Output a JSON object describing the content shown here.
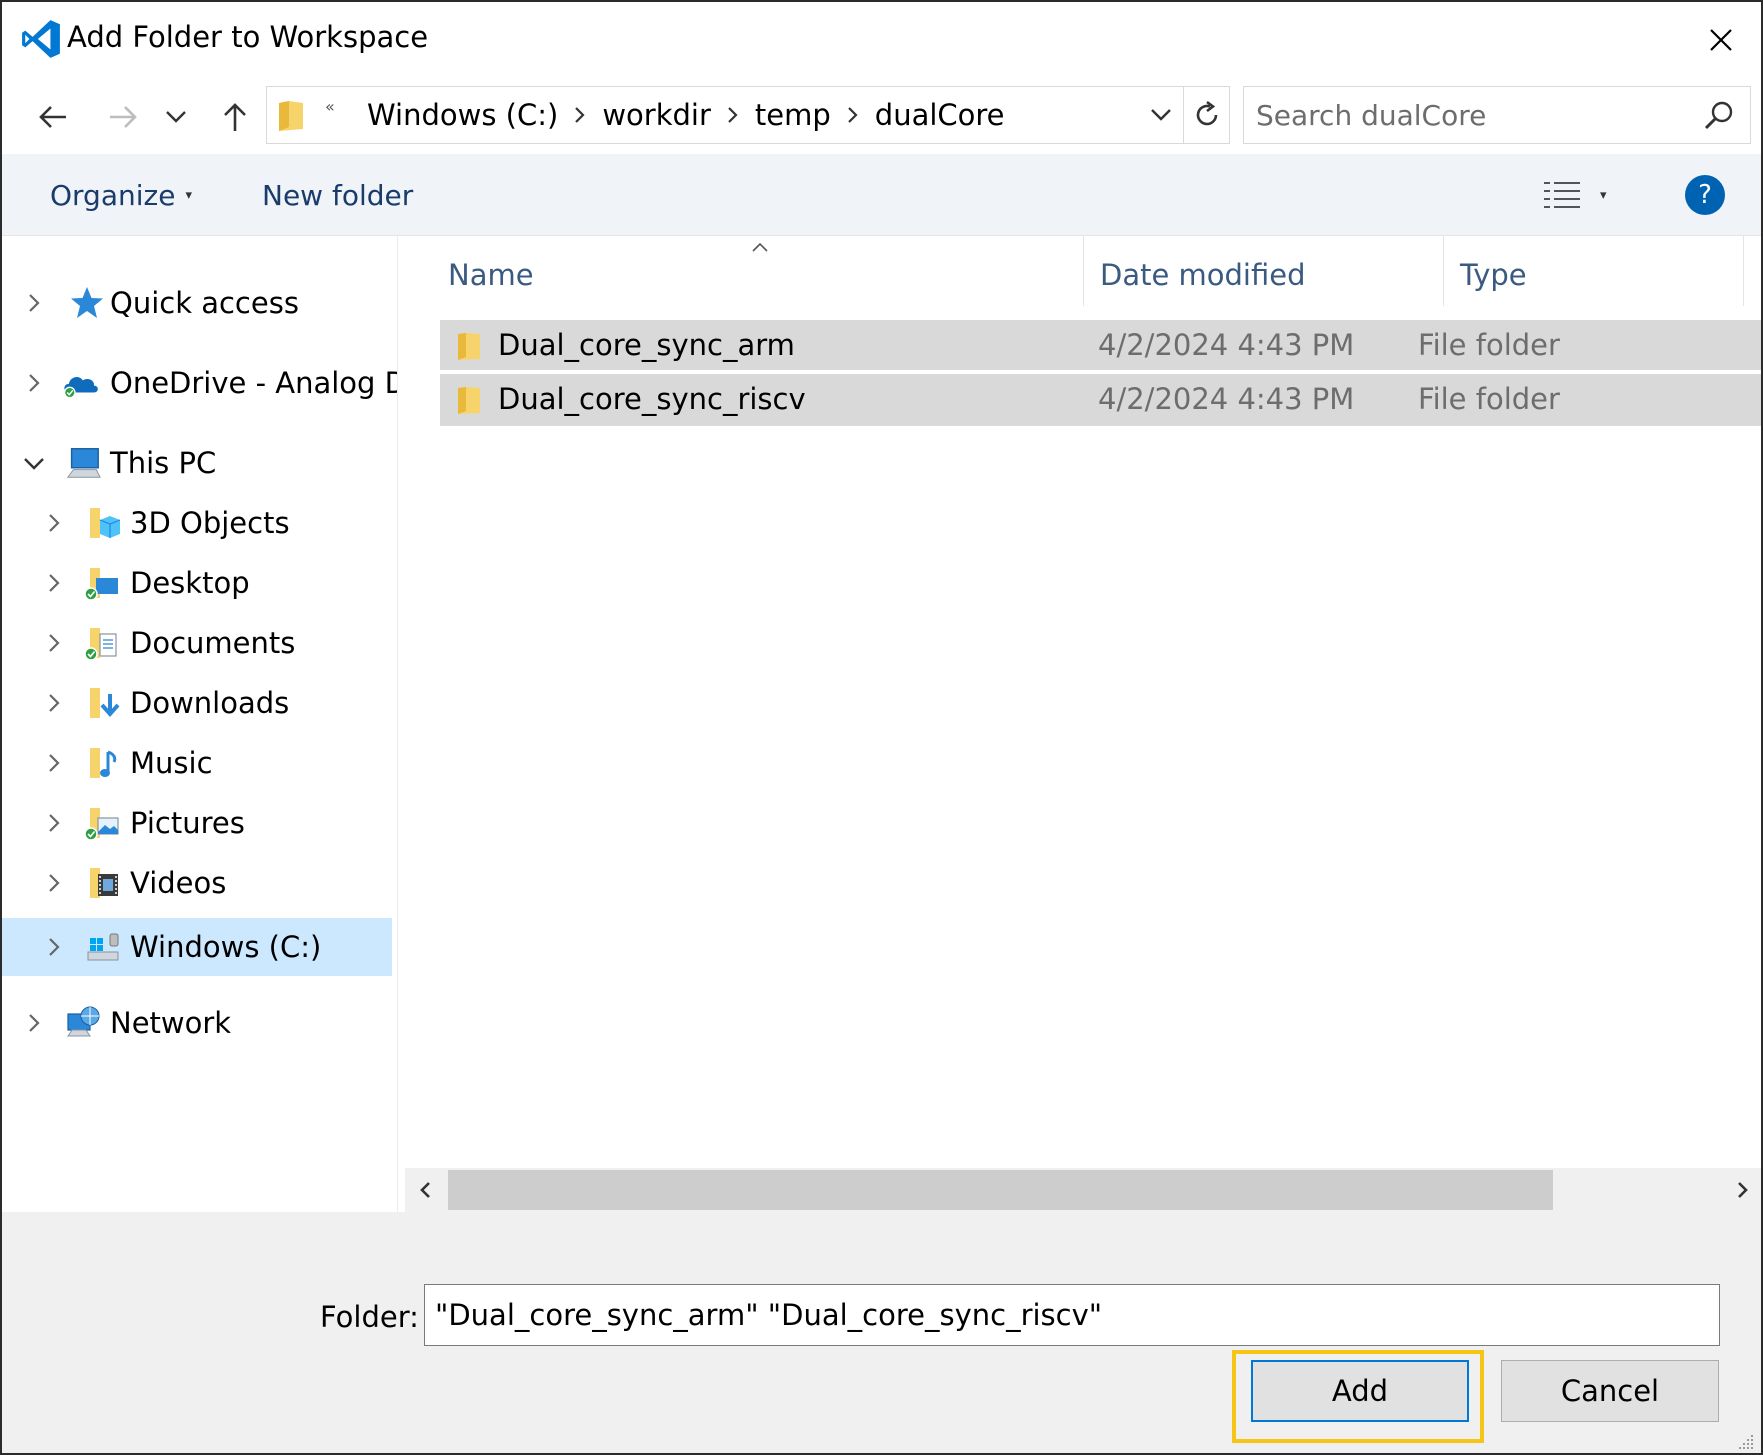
{
  "window": {
    "title": "Add Folder to Workspace",
    "app_icon": "vscode-icon",
    "close_icon": "close-icon"
  },
  "nav": {
    "back_icon": "arrow-left-icon",
    "forward_icon": "arrow-right-icon",
    "recent_icon": "chevron-down-icon",
    "up_icon": "arrow-up-icon",
    "address": {
      "overflow": "«",
      "crumbs": [
        "Windows (C:)",
        "workdir",
        "temp",
        "dualCore"
      ]
    },
    "refresh_icon": "refresh-icon",
    "search": {
      "placeholder": "Search dualCore"
    }
  },
  "toolbar": {
    "organize_label": "Organize",
    "new_folder_label": "New folder",
    "help_label": "?"
  },
  "sidebar": {
    "items": [
      {
        "label": "Quick access",
        "icon": "star-icon",
        "expanded": false
      },
      {
        "label": "OneDrive - Analog De",
        "icon": "onedrive-cloud-icon",
        "expanded": false
      },
      {
        "label": "This PC",
        "icon": "computer-icon",
        "expanded": true
      },
      {
        "label": "3D Objects",
        "icon": "3d-objects-folder-icon",
        "expanded": false
      },
      {
        "label": "Desktop",
        "icon": "desktop-folder-icon",
        "expanded": false
      },
      {
        "label": "Documents",
        "icon": "documents-folder-icon",
        "expanded": false
      },
      {
        "label": "Downloads",
        "icon": "downloads-folder-icon",
        "expanded": false
      },
      {
        "label": "Music",
        "icon": "music-folder-icon",
        "expanded": false
      },
      {
        "label": "Pictures",
        "icon": "pictures-folder-icon",
        "expanded": false
      },
      {
        "label": "Videos",
        "icon": "videos-folder-icon",
        "expanded": false
      },
      {
        "label": "Windows (C:)",
        "icon": "drive-icon",
        "expanded": false,
        "selected": true
      },
      {
        "label": "Network",
        "icon": "network-icon",
        "expanded": false
      }
    ]
  },
  "files": {
    "columns": [
      "Name",
      "Date modified",
      "Type"
    ],
    "rows": [
      {
        "name": "Dual_core_sync_arm",
        "date": "4/2/2024 4:43 PM",
        "type": "File folder"
      },
      {
        "name": "Dual_core_sync_riscv",
        "date": "4/2/2024 4:43 PM",
        "type": "File folder"
      }
    ]
  },
  "footer": {
    "folder_label": "Folder:",
    "folder_value": "\"Dual_core_sync_arm\" \"Dual_core_sync_riscv\"",
    "add_label": "Add",
    "cancel_label": "Cancel"
  },
  "colors": {
    "accent": "#0078d7",
    "selection": "#cce8ff",
    "row_selected": "#d9d9d9",
    "focus_highlight": "#f5c518",
    "toolbar_bg": "#f0f4f9"
  }
}
